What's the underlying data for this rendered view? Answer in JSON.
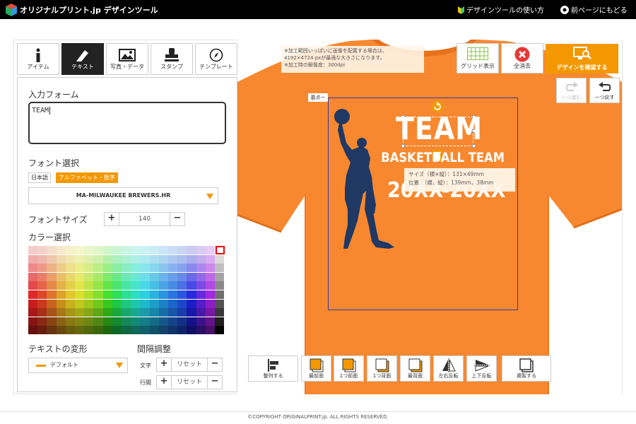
{
  "header": {
    "brand": "オリジナルプリント.jp デザインツール",
    "guide_link": "デザインツールの使い方",
    "back_link": "前ページにもどる"
  },
  "tabs": [
    {
      "label": "アイテム",
      "icon": "info-icon"
    },
    {
      "label": "テキスト",
      "icon": "pen-icon",
      "active": true
    },
    {
      "label": "写真・データ",
      "icon": "image-icon"
    },
    {
      "label": "スタンプ",
      "icon": "stamp-icon"
    },
    {
      "label": "テンプレート",
      "icon": "compass-icon"
    }
  ],
  "panel": {
    "input_label": "入力フォーム",
    "input_value": "TEAM",
    "font_label": "フォント選択",
    "font_tabs": [
      "日本語",
      "アルファベット・数字"
    ],
    "font_selected": "MA-MILWAUKEE BREWERS.HR",
    "size_label": "フォントサイズ",
    "size_value": "140",
    "color_label": "カラー選択",
    "transform_label": "テキストの変形",
    "transform_value": "デフォルト",
    "spacing_label": "間隔調整",
    "spacing_char_label": "文字",
    "spacing_line_label": "行間",
    "reset_label": "リセット"
  },
  "canvas": {
    "note_lines": [
      "※加工範囲いっぱいに画像を配置する場合は、",
      "4192×4724 pxが最適な大きさになります。",
      "※加工時の解像度：300dpi"
    ],
    "grid_label": "グリッド表示",
    "clear_label": "全消去",
    "confirm_label": "デザインを確認する",
    "redo_label": "一つ進む",
    "undo_label": "一つ戻す",
    "start_point": "基点ー",
    "design_title": "TEAM",
    "design_sub1": "BASKETBALL TEAM",
    "design_sub2": "20XX-20XX",
    "info_size": "サイズ（横×縦）：131×49mm",
    "info_pos": "位置　（横，縦）：139mm，38mm",
    "shirt_color": "#f7882f",
    "silhouette_color": "#1f3864"
  },
  "bottom_bar": [
    "整列する",
    "最前面",
    "1つ前面",
    "1つ背面",
    "最背面",
    "左右反転",
    "上下反転",
    "複製する"
  ],
  "footer": "©COPYRIGHT ORIGINALPRINT.jp. ALL RIGHTS RESERVED."
}
